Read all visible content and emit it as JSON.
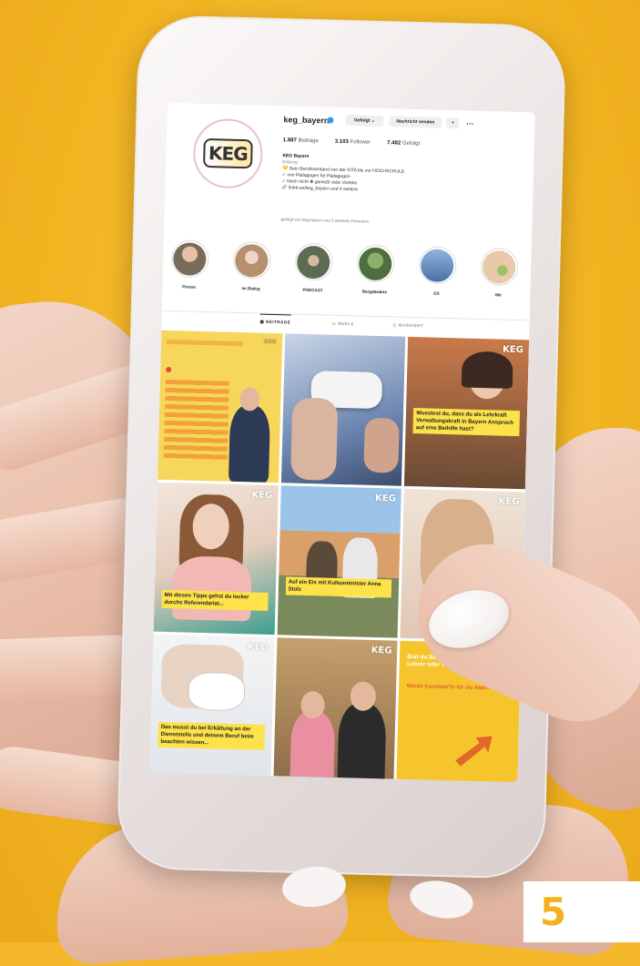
{
  "profile": {
    "username": "keg_bayern",
    "avatar_logo": "KEG",
    "buttons": {
      "following": "Gefolgt ⌄",
      "message": "Nachricht senden",
      "add_user": "+",
      "more": "···"
    },
    "stats": {
      "posts": "1.987",
      "posts_label": "Beiträge",
      "followers": "3.103",
      "followers_label": "Follower",
      "following": "7.482",
      "following_label": "Gefolgt"
    },
    "bio": {
      "name": "KEG Bayern",
      "category": "Bildung",
      "line1": "💛 Dein Berufsverband von der KITA bis zur HOCHSCHULE",
      "line2": "✓ von Pädagogen für Pädagogen",
      "line3": "✓ Noch nicht ✚ genießt viele Vorteile",
      "line4": "🔗 linktr.ee/keg_bayern und 4 weitere"
    },
    "followed_by": "gefolgt von keg.bayern und 3 weiteren Personen"
  },
  "highlights": [
    {
      "label": "Presse",
      "color": "#7a6a5a"
    },
    {
      "label": "im Dialog",
      "color": "#b58f6e"
    },
    {
      "label": "PODCAST",
      "color": "#5d6b52"
    },
    {
      "label": "Bergabwärts",
      "color": "#4d6f3f"
    },
    {
      "label": "GS",
      "color": "#4a6fa3"
    },
    {
      "label": "Wir",
      "color": "#e8c9a8"
    }
  ],
  "tabs": {
    "posts": "▦ BEITRÄGE",
    "reels": "▷ REELS",
    "tagged": "◻ MARKIERT"
  },
  "posts": [
    {
      "caption": "",
      "badge": "KEG"
    },
    {
      "caption": "",
      "badge": ""
    },
    {
      "caption": "Wusstest du, dass du als Lehrkraft Verwaltungskraft in Bayern Anspruch auf eine Beihilfe hast?",
      "badge": "KEG"
    },
    {
      "caption": "Mit diesen Tipps gehst du locker durchs Referendariat...",
      "badge": "KEG"
    },
    {
      "caption": "Auf ein Eis mit Kultusminister Anna Stolz",
      "badge": "KEG"
    },
    {
      "caption": "",
      "badge": "KEG"
    },
    {
      "caption": "Das musst du bei Erkältung an der Dienststelle und deinem Beruf beim beachten wissen...",
      "badge": "KEG"
    },
    {
      "caption": "",
      "badge": "KEG"
    },
    {
      "caption": "Bist du Bewerber, Referendar, Lehrer oder Verwaltung?",
      "caption2": "Werde Kandidat*in für die Wahl!",
      "badge": ""
    }
  ],
  "page_number": "5"
}
